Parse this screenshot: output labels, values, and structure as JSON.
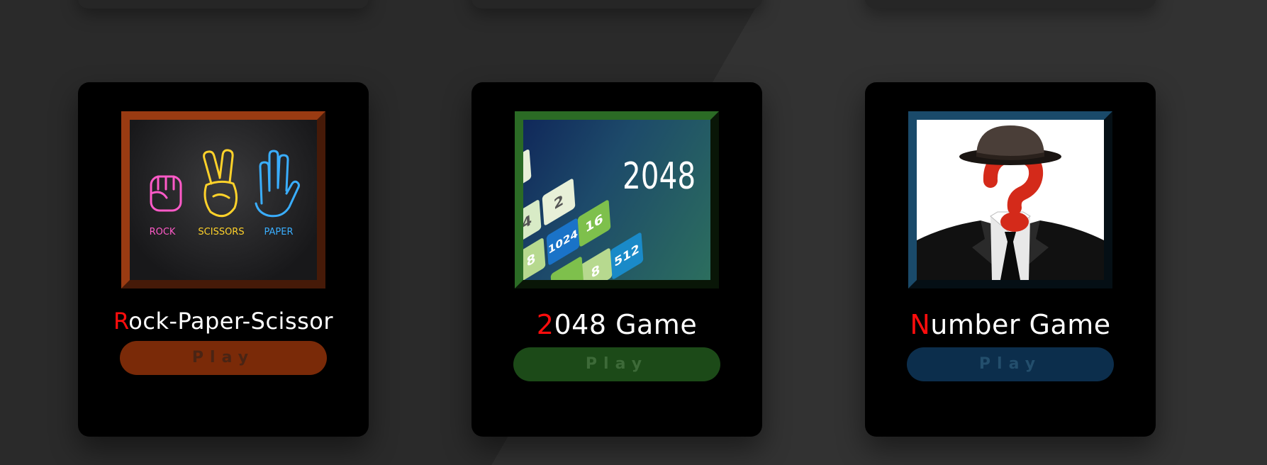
{
  "games": [
    {
      "id": "rps",
      "title_first": "R",
      "title_rest": "ock-Paper-Scissor",
      "play_label": "Play",
      "image": {
        "labels": [
          "ROCK",
          "SCISSORS",
          "PAPER"
        ]
      }
    },
    {
      "id": "2048",
      "title_first": "2",
      "title_rest": "048 Game",
      "play_label": "Play",
      "image": {
        "heading": "2048",
        "tiles": [
          "4",
          "2",
          "8",
          "1024",
          "16",
          "512",
          "8"
        ]
      }
    },
    {
      "id": "number",
      "title_first": "N",
      "title_rest": "umber Game",
      "play_label": "Play"
    }
  ],
  "colors": {
    "title_accent": "#ff0d0d",
    "rps_frame": "#9a3b12",
    "game2048_frame": "#2b6b25",
    "number_frame": "#1a4a6a"
  }
}
